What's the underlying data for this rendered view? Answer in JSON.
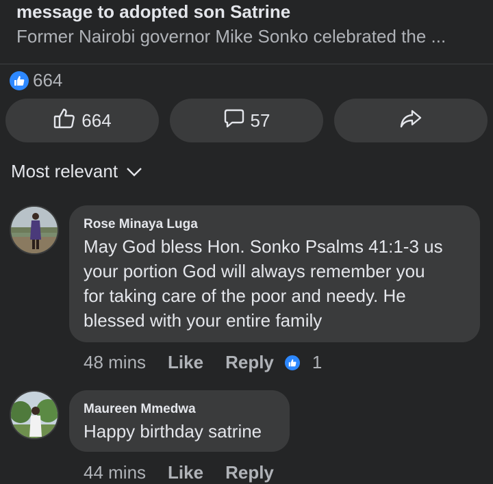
{
  "post": {
    "title": "message to adopted son Satrine",
    "subtitle": "Former Nairobi governor Mike Sonko celebrated the ..."
  },
  "reactions": {
    "count": "664"
  },
  "actions": {
    "like_count": "664",
    "comment_count": "57"
  },
  "sort": {
    "label": "Most relevant"
  },
  "comments": [
    {
      "author": "Rose Minaya Luga",
      "lines": [
        "May God bless Hon. Sonko Psalms 41:1-3 us",
        "your portion God will always remember you",
        "for taking care of the poor and needy. He",
        "blessed with your entire family"
      ],
      "time": "48 mins",
      "like_label": "Like",
      "reply_label": "Reply",
      "reaction_count": "1"
    },
    {
      "author": "Maureen Mmedwa",
      "lines": [
        "Happy birthday satrine"
      ],
      "time": "44 mins",
      "like_label": "Like",
      "reply_label": "Reply"
    }
  ],
  "colors": {
    "background": "#242526",
    "surface": "#3a3b3c",
    "accent": "#2d88ff",
    "text_primary": "#e4e6eb",
    "text_secondary": "#b0b3b8"
  }
}
